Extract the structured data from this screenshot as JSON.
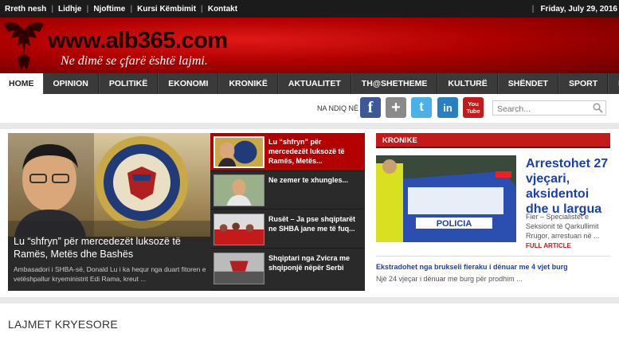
{
  "topbar": {
    "links": [
      "Rreth nesh",
      "Lidhje",
      "Njoftime",
      "Kursi Këmbimit",
      "Kontakt"
    ],
    "date": "Friday, July 29, 2016"
  },
  "header": {
    "logo": "www.alb365.com",
    "tagline": "Ne dimë se çfarë është lajmi."
  },
  "nav": {
    "items": [
      "HOME",
      "OPINION",
      "POLITIKË",
      "EKONOMI",
      "KRONIKË",
      "AKTUALITET",
      "TH@SHETHEME",
      "KULTURË",
      "SHËNDET",
      "SPORT",
      "BOTA"
    ],
    "active": "HOME"
  },
  "social": {
    "label": "NA NDIQ NË",
    "icons": [
      "facebook-icon",
      "google-plus-icon",
      "twitter-icon",
      "linkedin-icon",
      "youtube-icon"
    ],
    "search_placeholder": "Search..."
  },
  "featured": {
    "main_title": "Lu “shfryn” për mercedezët luksozë të Ramës, Metës dhe Bashës",
    "main_excerpt": "Ambasadori i SHBA-së, Donald Lu i ka hequr nga duart fitoren e vetëshpallur kryeministrit Edi Rama, kreut ...",
    "side": [
      "Lu “shfryn” për mercedezët luksozë të Ramës, Metës...",
      "Ne zemer te xhungles...",
      "Rusët – Ja pse shqiptarët ne SHBA jane me të fuq...",
      "Shqiptari nga Zvicra me shqiponjë nëpër Serbi"
    ]
  },
  "kronike": {
    "header": "KRONIKE",
    "title": "Arrestohet 27 vjeçari, aksidentoi dhe u largua",
    "excerpt": "Fier – Specialistët e Seksionit të Qarkullimit Rrugor, arrestuan në ...",
    "more": "FULL ARTICLE",
    "link": "Ekstradohet nga brukseli fieraku i dënuar me 4 vjet burg",
    "sub": "Një 24 vjeçar i dënuar me burg për prodhim ..."
  },
  "section_title": "LAJMET KRYESORE",
  "colors": {
    "brand_red": "#c41a1a",
    "nav_bg": "#3a3a3a",
    "link_blue": "#1a3fb0"
  }
}
